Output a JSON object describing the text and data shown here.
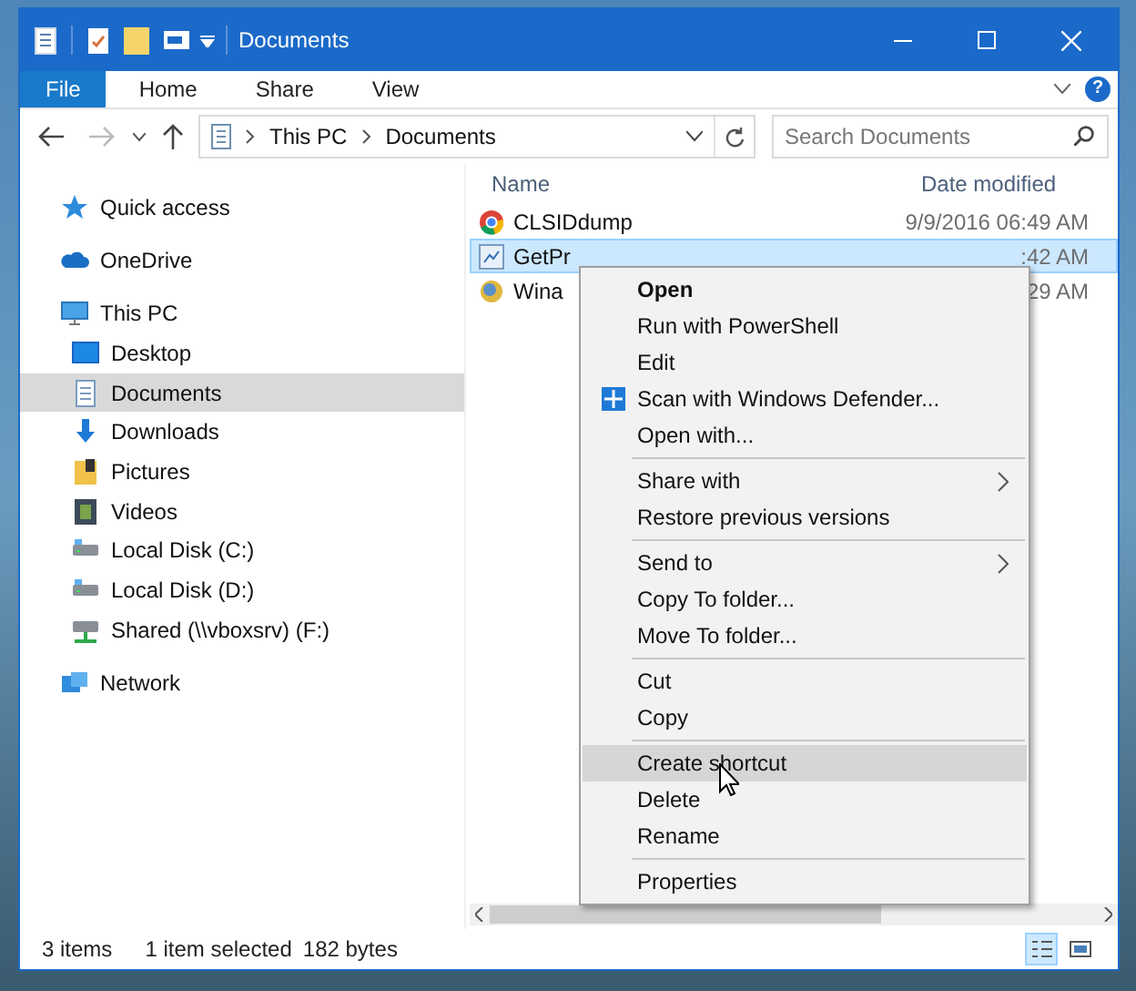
{
  "window": {
    "title": "Documents"
  },
  "ribbon": {
    "help": "?",
    "tabs": [
      {
        "label": "File",
        "selected": true
      },
      {
        "label": "Home",
        "selected": false
      },
      {
        "label": "Share",
        "selected": false
      },
      {
        "label": "View",
        "selected": false
      }
    ]
  },
  "address_bar": {
    "path": [
      "This PC",
      "Documents"
    ]
  },
  "search": {
    "placeholder": "Search Documents"
  },
  "nav_pane": {
    "items": [
      {
        "label": "Quick access",
        "kind": "star",
        "selected": false
      },
      {
        "label": "OneDrive",
        "kind": "cloud",
        "selected": false
      },
      {
        "label": "This PC",
        "kind": "pc",
        "selected": false,
        "children": [
          {
            "label": "Desktop",
            "kind": "desktop",
            "selected": false
          },
          {
            "label": "Documents",
            "kind": "doc",
            "selected": true
          },
          {
            "label": "Downloads",
            "kind": "download",
            "selected": false
          },
          {
            "label": "Pictures",
            "kind": "pictures",
            "selected": false
          },
          {
            "label": "Videos",
            "kind": "videos",
            "selected": false
          },
          {
            "label": "Local Disk (C:)",
            "kind": "disk",
            "selected": false
          },
          {
            "label": "Local Disk (D:)",
            "kind": "disk",
            "selected": false
          },
          {
            "label": "Shared (\\\\vboxsrv) (F:)",
            "kind": "netdrive",
            "selected": false
          }
        ]
      },
      {
        "label": "Network",
        "kind": "network",
        "selected": false
      }
    ]
  },
  "file_list": {
    "columns": [
      "Name",
      "Date modified"
    ],
    "rows": [
      {
        "name": "CLSIDdump",
        "date": "9/9/2016 06:49 AM",
        "kind": "chrome",
        "selected": false
      },
      {
        "name": "GetPr",
        "date": ":42 AM",
        "kind": "script",
        "selected": true
      },
      {
        "name": "Wina",
        "date": "29 AM",
        "kind": "app",
        "selected": false
      }
    ]
  },
  "context_menu": {
    "items": [
      {
        "kind": "item",
        "label": "Open",
        "bold": true,
        "selected": false
      },
      {
        "kind": "item",
        "label": "Run with PowerShell",
        "selected": false
      },
      {
        "kind": "item",
        "label": "Edit",
        "selected": false
      },
      {
        "kind": "shield_item",
        "label": "Scan with Windows Defender...",
        "selected": false
      },
      {
        "kind": "item",
        "label": "Open with...",
        "selected": false
      },
      {
        "kind": "separator"
      },
      {
        "kind": "item",
        "label": "Share with",
        "submenu": true,
        "selected": false
      },
      {
        "kind": "item",
        "label": "Restore previous versions",
        "selected": false
      },
      {
        "kind": "separator"
      },
      {
        "kind": "item",
        "label": "Send to",
        "submenu": true,
        "selected": false
      },
      {
        "kind": "item",
        "label": "Copy To folder...",
        "selected": false
      },
      {
        "kind": "item",
        "label": "Move To folder...",
        "selected": false
      },
      {
        "kind": "separator"
      },
      {
        "kind": "item",
        "label": "Cut",
        "selected": false
      },
      {
        "kind": "item",
        "label": "Copy",
        "selected": false
      },
      {
        "kind": "separator"
      },
      {
        "kind": "item",
        "label": "Create shortcut",
        "selected": true
      },
      {
        "kind": "item",
        "label": "Delete",
        "selected": false
      },
      {
        "kind": "item",
        "label": "Rename",
        "selected": false
      },
      {
        "kind": "separator"
      },
      {
        "kind": "item",
        "label": "Properties",
        "selected": false
      }
    ]
  },
  "status_bar": {
    "count": "3 items",
    "selection": "1 item selected",
    "size": "182 bytes",
    "views": [
      {
        "kind": "details",
        "selected": true
      },
      {
        "kind": "thumbnails",
        "selected": false
      }
    ]
  }
}
